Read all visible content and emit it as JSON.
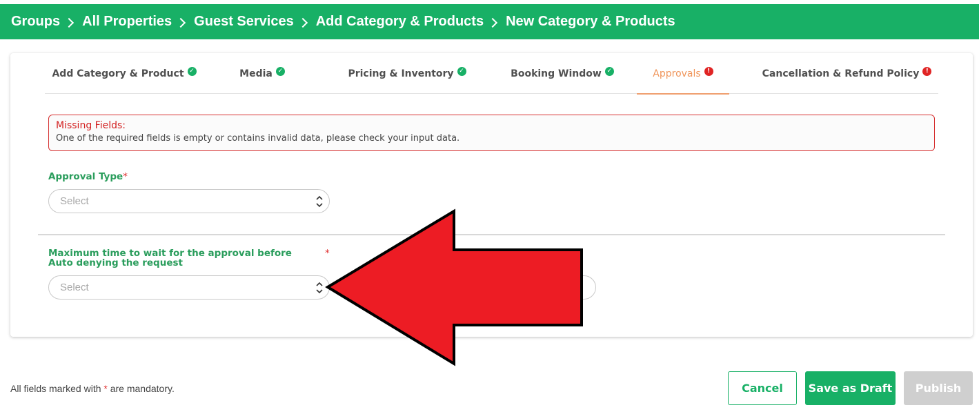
{
  "breadcrumb": [
    "Groups",
    "All Properties",
    "Guest Services",
    "Add Category & Products",
    "New Category & Products"
  ],
  "tabs": [
    {
      "label": "Add Category & Product",
      "status": "ok"
    },
    {
      "label": "Media",
      "status": "ok"
    },
    {
      "label": "Pricing & Inventory",
      "status": "ok"
    },
    {
      "label": "Booking Window",
      "status": "ok"
    },
    {
      "label": "Approvals",
      "status": "error",
      "active": true
    },
    {
      "label": "Cancellation & Refund Policy",
      "status": "error"
    }
  ],
  "alert": {
    "title": "Missing Fields:",
    "message": "One of the required fields is empty or contains invalid data, please check your input data."
  },
  "form": {
    "approval_type_label": "Approval Type",
    "approval_type_placeholder": "Select",
    "max_wait_label": "Maximum time to wait for the approval before Auto denying the request",
    "max_wait_placeholder": "Select",
    "required_mark": "*"
  },
  "footer": {
    "mandatory_prefix": "All fields marked with",
    "mandatory_star": "*",
    "mandatory_suffix": "are mandatory.",
    "cancel": "Cancel",
    "save_draft": "Save as Draft",
    "publish": "Publish"
  },
  "colors": {
    "brand_green": "#18b066",
    "error_red": "#e02424",
    "active_tab": "#f0955a",
    "annotation_arrow": "#ed1c24"
  },
  "icons": {
    "check": "check-circle-icon",
    "error": "alert-circle-icon",
    "breadcrumb_separator": "chevron-right-icon",
    "select_toggle": "chevron-updown-icon"
  }
}
